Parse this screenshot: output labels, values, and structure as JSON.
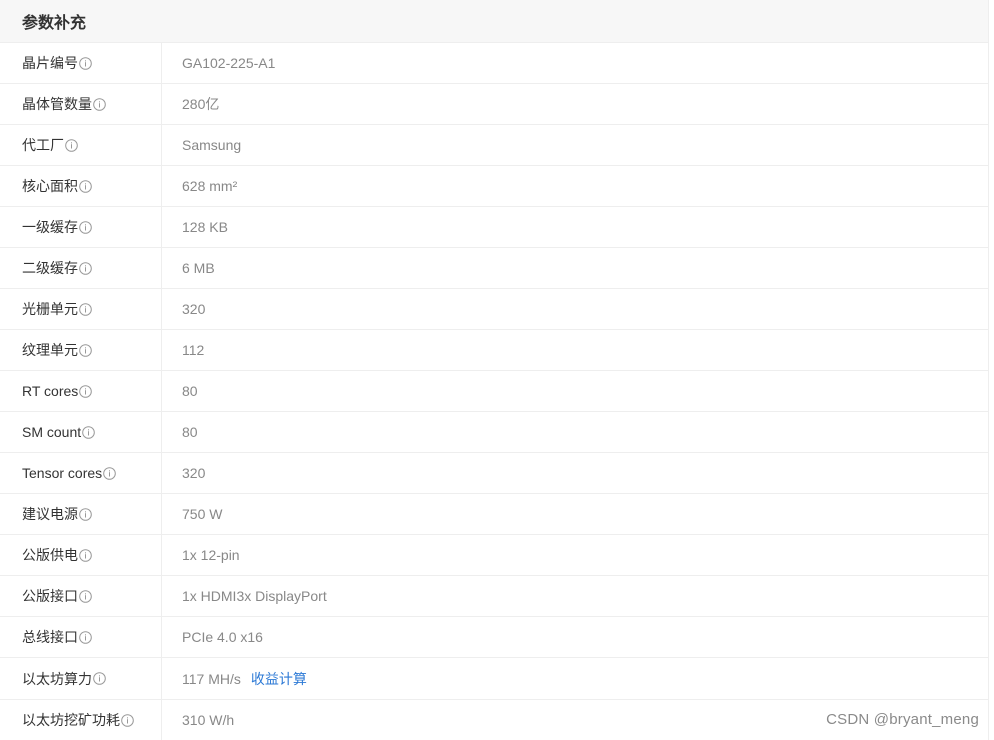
{
  "section": {
    "title": "参数补充"
  },
  "rows": [
    {
      "label": "晶片编号",
      "value": "GA102-225-A1"
    },
    {
      "label": "晶体管数量",
      "value": "280亿"
    },
    {
      "label": "代工厂",
      "value": "Samsung"
    },
    {
      "label": "核心面积",
      "value": "628 mm²"
    },
    {
      "label": "一级缓存",
      "value": "128 KB"
    },
    {
      "label": "二级缓存",
      "value": "6 MB"
    },
    {
      "label": "光栅单元",
      "value": "320"
    },
    {
      "label": "纹理单元",
      "value": "112"
    },
    {
      "label": "RT cores",
      "value": "80"
    },
    {
      "label": "SM count",
      "value": "80"
    },
    {
      "label": "Tensor cores",
      "value": "320"
    },
    {
      "label": "建议电源",
      "value": "750 W"
    },
    {
      "label": "公版供电",
      "value": "1x 12-pin"
    },
    {
      "label": "公版接口",
      "value": "1x HDMI3x DisplayPort"
    },
    {
      "label": "总线接口",
      "value": "PCIe 4.0 x16"
    },
    {
      "label": "以太坊算力",
      "value": "117 MH/s",
      "link": "收益计算"
    },
    {
      "label": "以太坊挖矿功耗",
      "value": "310 W/h"
    }
  ],
  "watermark": "CSDN @bryant_meng",
  "icons": {
    "info": "info-circle-icon"
  },
  "colors": {
    "label_text": "#333333",
    "value_text": "#888888",
    "link": "#2d7ad6",
    "header_bg": "#f7f7f7",
    "border": "#eeeeee",
    "icon": "#999999"
  }
}
